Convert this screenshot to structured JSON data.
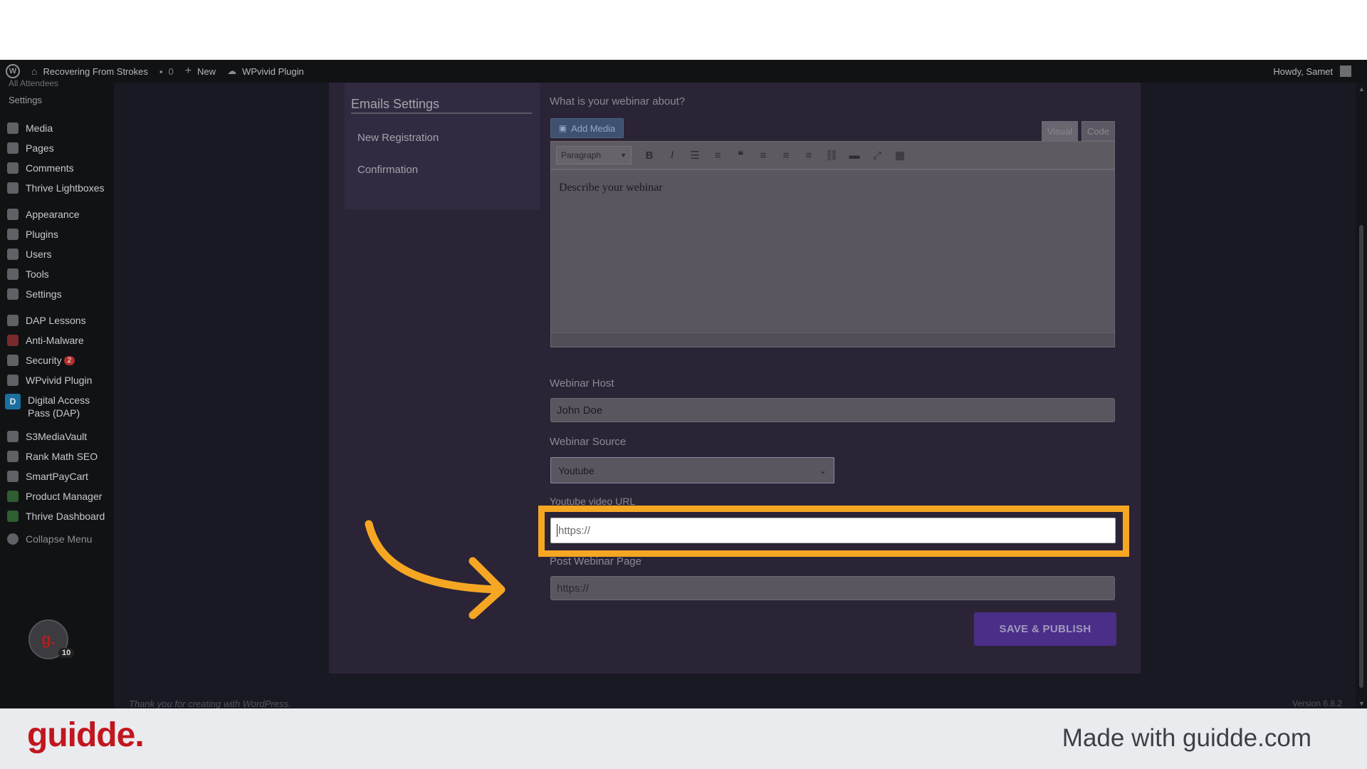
{
  "adminbar": {
    "site_name": "Recovering From Strokes",
    "comments_count": "0",
    "new_label": "New",
    "plugin_label": "WPvivid Plugin",
    "greeting": "Howdy, Samet"
  },
  "sidebar": {
    "cut_item": "All Attendees",
    "settings_sub": "Settings",
    "items": [
      {
        "label": "Media",
        "icon": "media-icon"
      },
      {
        "label": "Pages",
        "icon": "pages-icon"
      },
      {
        "label": "Comments",
        "icon": "comments-icon"
      },
      {
        "label": "Thrive Lightboxes",
        "icon": "pin-icon"
      },
      {
        "label": "Appearance",
        "icon": "appearance-icon"
      },
      {
        "label": "Plugins",
        "icon": "plugins-icon"
      },
      {
        "label": "Users",
        "icon": "users-icon"
      },
      {
        "label": "Tools",
        "icon": "tools-icon"
      },
      {
        "label": "Settings",
        "icon": "settings-icon"
      },
      {
        "label": "DAP Lessons",
        "icon": "book-icon"
      },
      {
        "label": "Anti-Malware",
        "icon": "shield-icon"
      },
      {
        "label": "Security",
        "icon": "lock-icon",
        "badge": "2"
      },
      {
        "label": "WPvivid Plugin",
        "icon": "cloud-icon"
      },
      {
        "label": "Digital Access Pass (DAP)",
        "icon": "dap-icon"
      },
      {
        "label": "S3MediaVault",
        "icon": "gear-icon"
      },
      {
        "label": "Rank Math SEO",
        "icon": "gear-icon"
      },
      {
        "label": "SmartPayCart",
        "icon": "gear-icon"
      },
      {
        "label": "Product Manager",
        "icon": "leaf-icon"
      },
      {
        "label": "Thrive Dashboard",
        "icon": "leaf-icon"
      }
    ],
    "collapse_label": "Collapse Menu",
    "avatar_letter": "g.",
    "avatar_count": "10"
  },
  "emails_panel": {
    "title": "Emails Settings",
    "items": [
      "New Registration",
      "Confirmation"
    ]
  },
  "form": {
    "about_label": "What is your webinar about?",
    "add_media_label": "Add Media",
    "tab_visual": "Visual",
    "tab_code": "Code",
    "format_select": "Paragraph",
    "editor_placeholder": "Describe your webinar",
    "host_label": "Webinar Host",
    "host_value": "John Doe",
    "source_label": "Webinar Source",
    "source_value": "Youtube",
    "youtube_label": "Youtube video URL",
    "youtube_placeholder": "https://",
    "post_page_label": "Post Webinar Page",
    "post_page_placeholder": "https://",
    "save_label": "SAVE & PUBLISH"
  },
  "footer": {
    "thanks": "Thank you for creating with WordPress.",
    "version": "Version 6.8.2"
  },
  "branding": {
    "logo": "guidde.",
    "made_with": "Made with guidde.com"
  },
  "colors": {
    "highlight": "#f5a623",
    "brand_red": "#c1161e",
    "save_button": "#4a2e87"
  }
}
